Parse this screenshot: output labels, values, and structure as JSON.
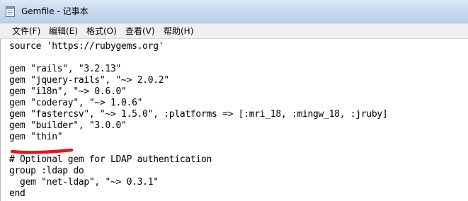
{
  "window": {
    "title": "Gemfile - 记事本",
    "app_icon": "notepad-icon"
  },
  "menu": {
    "items": [
      {
        "label": "文件(F)"
      },
      {
        "label": "编辑(E)"
      },
      {
        "label": "格式(O)"
      },
      {
        "label": "查看(V)"
      },
      {
        "label": "帮助(H)"
      }
    ]
  },
  "editor": {
    "lines": [
      "source 'https://rubygems.org'",
      "",
      "gem \"rails\", \"3.2.13\"",
      "gem \"jquery-rails\", \"~> 2.0.2\"",
      "gem \"i18n\", \"~> 0.6.0\"",
      "gem \"coderay\", \"~> 1.0.6\"",
      "gem \"fastercsv\", \"~> 1.5.0\", :platforms => [:mri_18, :mingw_18, :jruby]",
      "gem \"builder\", \"3.0.0\"",
      "gem \"thin\"",
      "",
      "# Optional gem for LDAP authentication",
      "group :ldap do",
      "  gem \"net-ldap\", \"~> 0.3.1\"",
      "end"
    ]
  },
  "annotation": {
    "type": "hand-drawn-underline",
    "color": "#e8141b",
    "target_line": "gem \"thin\""
  }
}
